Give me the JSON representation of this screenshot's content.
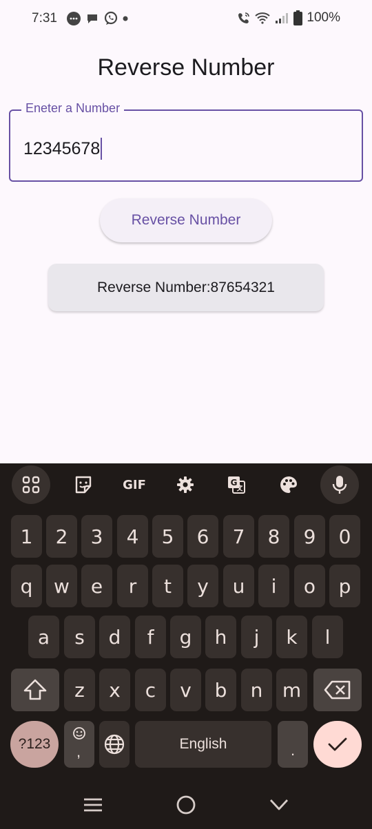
{
  "status_bar": {
    "time": "7:31",
    "battery": "100%",
    "left_icons": [
      "messages-icon",
      "chat-icon",
      "whatsapp-icon",
      "dot-icon"
    ],
    "right_icons": [
      "wifi-calling-icon",
      "wifi-icon",
      "signal-icon",
      "battery-icon"
    ]
  },
  "app": {
    "title": "Reverse Number",
    "input_label": "Eneter a Number",
    "input_value": "12345678",
    "button_label": "Reverse Number",
    "result_text": "Reverse Number:87654321"
  },
  "keyboard": {
    "toolbar": [
      "apps-grid-icon",
      "sticker-icon",
      "gif-icon",
      "settings-icon",
      "translate-icon",
      "palette-icon",
      "mic-icon"
    ],
    "gif_label": "GIF",
    "rows": [
      [
        "1",
        "2",
        "3",
        "4",
        "5",
        "6",
        "7",
        "8",
        "9",
        "0"
      ],
      [
        "q",
        "w",
        "e",
        "r",
        "t",
        "y",
        "u",
        "i",
        "o",
        "p"
      ],
      [
        "a",
        "s",
        "d",
        "f",
        "g",
        "h",
        "j",
        "k",
        "l"
      ],
      [
        "z",
        "x",
        "c",
        "v",
        "b",
        "n",
        "m"
      ]
    ],
    "symbols_label": "?123",
    "space_label": "English",
    "period_label": ".",
    "comma_label": ","
  },
  "nav_bar": [
    "menu-icon",
    "home-icon",
    "back-chevron-icon"
  ],
  "colors": {
    "accent": "#6750a4",
    "background": "#fdf8fd",
    "keyboard_bg": "#1f1a18",
    "key_bg": "#37302d",
    "enter_bg": "#ffdad4"
  }
}
